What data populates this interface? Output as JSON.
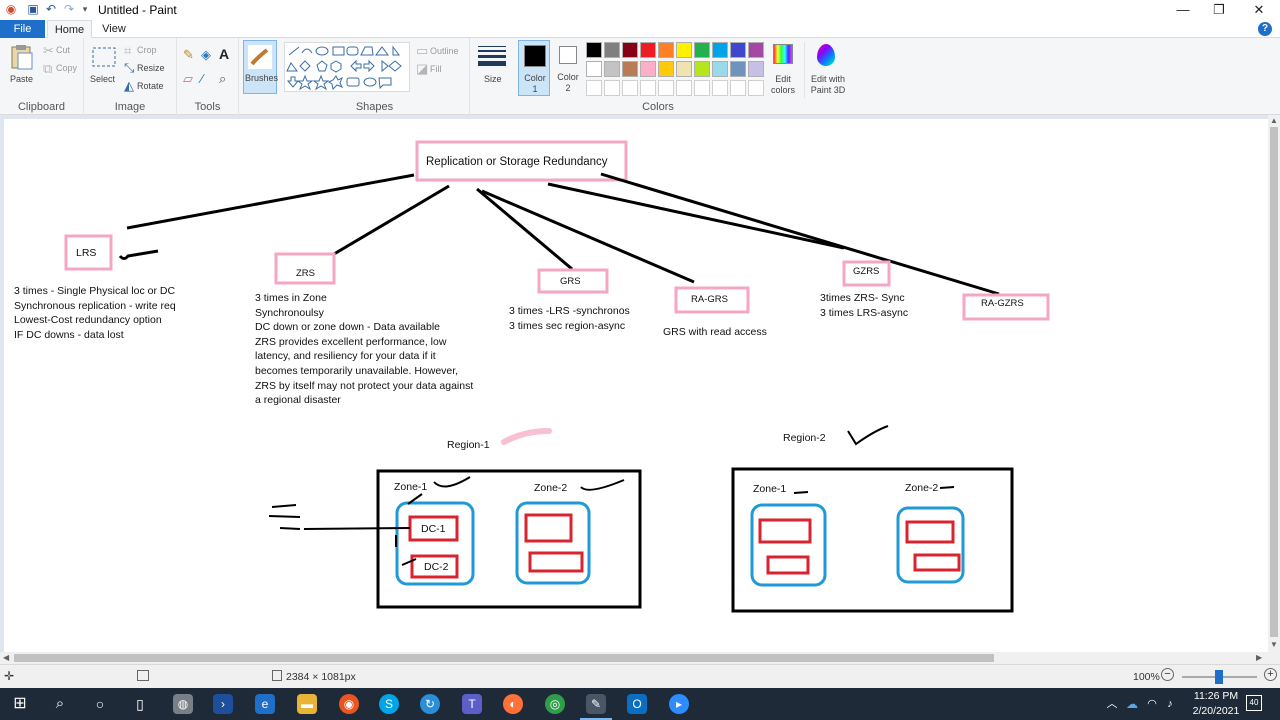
{
  "window": {
    "title": "Untitled - Paint"
  },
  "tabs": {
    "file": "File",
    "home": "Home",
    "view": "View"
  },
  "ribbon": {
    "clipboard": {
      "paste": "Paste",
      "cut": "Cut",
      "copy": "Copy",
      "group": "Clipboard"
    },
    "image": {
      "select": "Select",
      "crop": "Crop",
      "resize": "Resize",
      "rotate": "Rotate",
      "group": "Image"
    },
    "tools": {
      "group": "Tools"
    },
    "brushes": {
      "label": "Brushes"
    },
    "shapes": {
      "outline": "Outline",
      "fill": "Fill",
      "group": "Shapes"
    },
    "size": {
      "label": "Size"
    },
    "colors": {
      "color1": "Color 1",
      "color2": "Color 2",
      "edit": "Edit colors",
      "paint3d": "Edit with Paint 3D",
      "group": "Colors",
      "palette_row1": [
        "#000000",
        "#7f7f7f",
        "#880015",
        "#ed1c24",
        "#ff7f27",
        "#fff200",
        "#22b14c",
        "#00a2e8",
        "#3f48cc",
        "#a349a4"
      ],
      "palette_row2": [
        "#ffffff",
        "#c3c3c3",
        "#b97a57",
        "#ffaec9",
        "#ffc90e",
        "#efe4b0",
        "#b5e61d",
        "#99d9ea",
        "#7092be",
        "#c8bfe7"
      ]
    }
  },
  "canvas": {
    "root_box": "Replication or Storage Redundancy",
    "lrs": {
      "label": "LRS",
      "notes": [
        "3 times - Single Physical loc or DC",
        "Synchronous replication - write req",
        "Lowest-Cost redundancy option",
        "IF DC downs - data lost"
      ]
    },
    "zrs": {
      "label": "ZRS",
      "notes": [
        "3 times in Zone",
        "Synchronoulsy",
        "DC down or zone down - Data available",
        "ZRS provides excellent performance, low",
        "latency, and resiliency for your data if it",
        "becomes temporarily unavailable. However,",
        "ZRS by itself may not protect your data against",
        "a regional disaster"
      ]
    },
    "grs": {
      "label": "GRS",
      "notes": [
        "3 times -LRS -synchronos",
        "3 times sec region-async"
      ]
    },
    "ragrs": {
      "label": "RA-GRS",
      "notes": [
        "GRS with read access"
      ]
    },
    "gzrs": {
      "label": "GZRS",
      "notes": [
        "3times ZRS- Sync",
        "3 times LRS-async"
      ]
    },
    "ragzrs": {
      "label": "RA-GZRS"
    },
    "region1": {
      "label": "Region-1",
      "zone1": "Zone-1",
      "zone2": "Zone-2",
      "dc1": "DC-1",
      "dc2": "DC-2"
    },
    "region2": {
      "label": "Region-2",
      "zone1": "Zone-1",
      "zone2": "Zone-2"
    }
  },
  "status": {
    "dimensions": "2384 × 1081px",
    "zoom": "100%"
  },
  "taskbar": {
    "time": "11:26 PM",
    "date": "2/20/2021",
    "notifications": "40"
  }
}
